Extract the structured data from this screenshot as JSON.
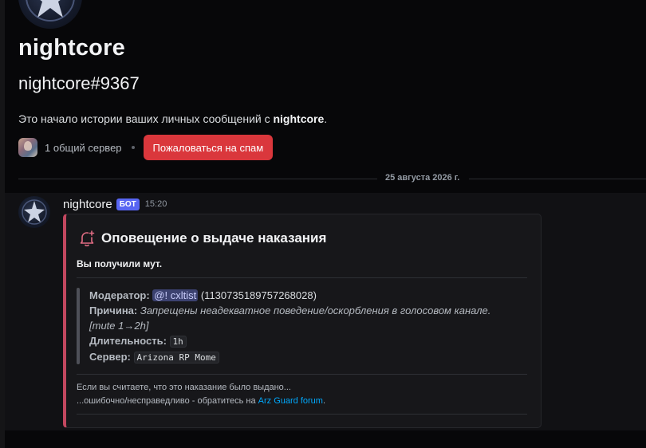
{
  "profile": {
    "display_name": "nightcore",
    "username": "nightcore#9367",
    "intro_prefix": "Это начало истории ваших личных сообщений с ",
    "intro_name": "nightcore",
    "intro_suffix": ".",
    "mutual_servers": "1 общий сервер",
    "spam_button": "Пожаловаться на спам"
  },
  "divider": {
    "date": "25 августа 2026 г."
  },
  "message": {
    "author": "nightcore",
    "bot_tag": "БОТ",
    "time": "15:20",
    "embed": {
      "accent_color": "#c2475f",
      "icon": "bell-plus-icon",
      "title": "Оповещение о выдаче наказания",
      "description": "Вы получили мут.",
      "fields": {
        "moderator_label": "Модератор:",
        "moderator_mention": "@! cxltist",
        "moderator_id": "(1130735189757268028)",
        "reason_label": "Причина:",
        "reason_value": "Запрещены неадекватное поведение/оскорбления в голосовом канале.",
        "reason_tag": "[mute 1→2h]",
        "duration_label": "Длительность:",
        "duration_value": "1h",
        "server_label": "Сервер:",
        "server_value": "Arizona RP Mome"
      },
      "footer": {
        "line1": "Если вы считаете, что это наказание было выдано...",
        "line2_prefix": "...ошибочно/несправедливо - обратитесь на ",
        "link": "Arz Guard forum",
        "line2_suffix": "."
      }
    }
  },
  "colors": {
    "background": "#070709",
    "message_bg": "#111114",
    "spam_button": "#da373c",
    "bot_tag": "#5865f2",
    "link": "#00a8fc"
  }
}
